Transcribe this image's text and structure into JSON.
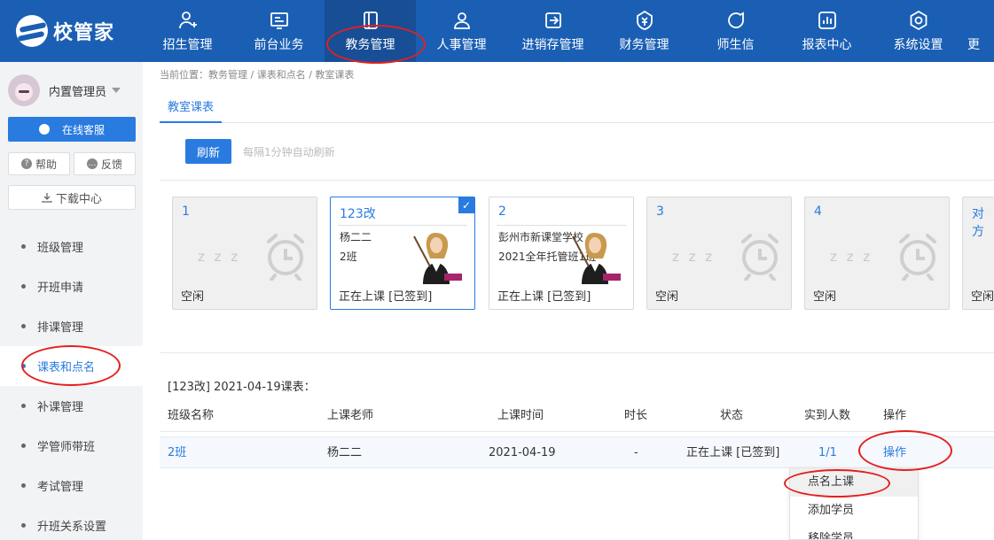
{
  "app": {
    "logo_text": "校管家"
  },
  "nav": [
    {
      "label": "招生管理",
      "icon": "user-plus-icon"
    },
    {
      "label": "前台业务",
      "icon": "monitor-icon"
    },
    {
      "label": "教务管理",
      "icon": "book-icon"
    },
    {
      "label": "人事管理",
      "icon": "person-icon"
    },
    {
      "label": "进销存管理",
      "icon": "inventory-icon"
    },
    {
      "label": "财务管理",
      "icon": "money-icon"
    },
    {
      "label": "师生信",
      "icon": "chat-icon"
    },
    {
      "label": "报表中心",
      "icon": "report-icon"
    },
    {
      "label": "系统设置",
      "icon": "settings-icon"
    },
    {
      "label": "更",
      "icon": "more-icon"
    }
  ],
  "sidebar": {
    "user_name": "内置管理员",
    "service_button": "在线客服",
    "help_button": "帮助",
    "feedback_button": "反馈",
    "download_button": "下载中心",
    "items": [
      {
        "label": "班级管理"
      },
      {
        "label": "开班申请"
      },
      {
        "label": "排课管理"
      },
      {
        "label": "课表和点名"
      },
      {
        "label": "补课管理"
      },
      {
        "label": "学管师带班"
      },
      {
        "label": "考试管理"
      },
      {
        "label": "升班关系设置"
      }
    ]
  },
  "breadcrumb": "当前位置：教务管理 / 课表和点名 / 教室课表",
  "tab": "教室课表",
  "refresh": {
    "button": "刷新",
    "hint": "每隔1分钟自动刷新"
  },
  "rooms": [
    {
      "number": "1",
      "status": "空闲"
    },
    {
      "number": "123改",
      "line1": "杨二二",
      "line2": "2班",
      "status": "正在上课 [已签到]"
    },
    {
      "number": "2",
      "line1": "彭州市新课堂学校",
      "line2": "2021全年托管班1班",
      "status": "正在上课 [已签到]"
    },
    {
      "number": "3",
      "status": "空闲"
    },
    {
      "number": "4",
      "status": "空闲"
    },
    {
      "number": "对方",
      "status": "空闲"
    }
  ],
  "idle_mark": "z z z",
  "schedule": {
    "title": "[123改] 2021-04-19课表：",
    "headers": [
      "班级名称",
      "上课老师",
      "上课时间",
      "时长",
      "状态",
      "实到人数",
      "操作"
    ],
    "row": [
      "2班",
      "杨二二",
      "2021-04-19",
      "-",
      "正在上课 [已签到]",
      "1/1",
      "操作"
    ]
  },
  "dropdown": [
    "点名上课",
    "添加学员",
    "移除学员"
  ],
  "colors": {
    "nav_bg": "#1a5fb4",
    "accent": "#2a7be0",
    "annotation": "#e32020"
  }
}
